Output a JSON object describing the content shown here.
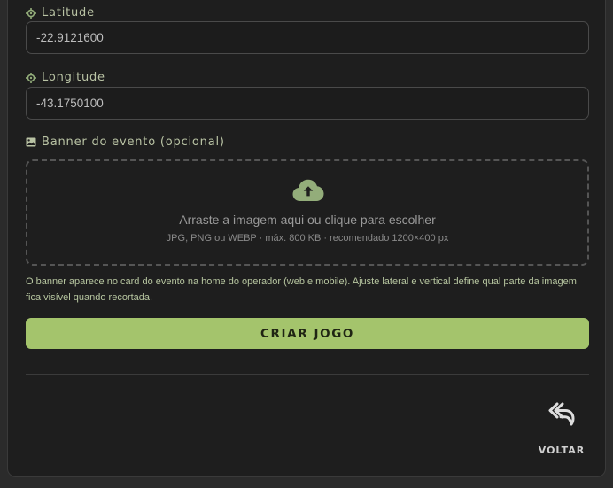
{
  "form": {
    "latitude": {
      "label": "Latitude",
      "value": "-22.9121600",
      "icon": "crosshair-icon"
    },
    "longitude": {
      "label": "Longitude",
      "value": "-43.1750100",
      "icon": "crosshair-icon"
    },
    "banner": {
      "label": "Banner do evento (opcional)",
      "icon": "image-icon",
      "dropzone_main": "Arraste a imagem aqui ou clique para escolher",
      "dropzone_sub": "JPG, PNG ou WEBP · máx. 800 KB · recomendado 1200×400 px",
      "dropzone_icon": "cloud-upload-icon",
      "help_text": "O banner aparece no card do evento na home do operador (web e mobile). Ajuste lateral e vertical define qual parte da imagem fica visível quando recortada."
    },
    "submit_label": "CRIAR JOGO"
  },
  "footer": {
    "back_label": "VOLTAR",
    "back_icon": "reply-all-icon"
  },
  "colors": {
    "accent": "#a4c46c",
    "panel_bg": "#1e1e1e",
    "label_text": "#b9c3a4",
    "icon_green": "#93ad7a"
  }
}
